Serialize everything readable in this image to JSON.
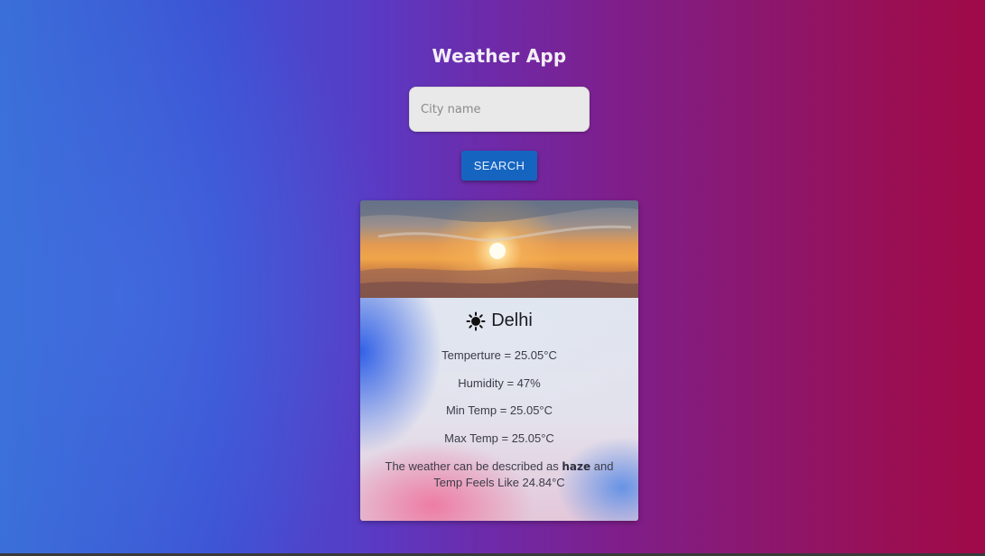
{
  "app": {
    "title": "Weather App"
  },
  "search": {
    "placeholder": "City name",
    "value": "",
    "button_label": "SEARCH"
  },
  "card": {
    "image_icon": "sunset-image",
    "weather_icon": "sun-icon",
    "city": "Delhi",
    "temperature": "Temperture = 25.05°C",
    "humidity": "Humidity = 47%",
    "min_temp": "Min Temp = 25.05°C",
    "max_temp": "Max Temp = 25.05°C",
    "description_prefix": "The weather can be described as",
    "description_value": "haze",
    "description_suffix": "and",
    "feels_like": "Temp Feels Like 24.84°C"
  },
  "colors": {
    "button": "#1565c0",
    "background_left": "#3a6fd8",
    "background_right": "#a00a48"
  }
}
